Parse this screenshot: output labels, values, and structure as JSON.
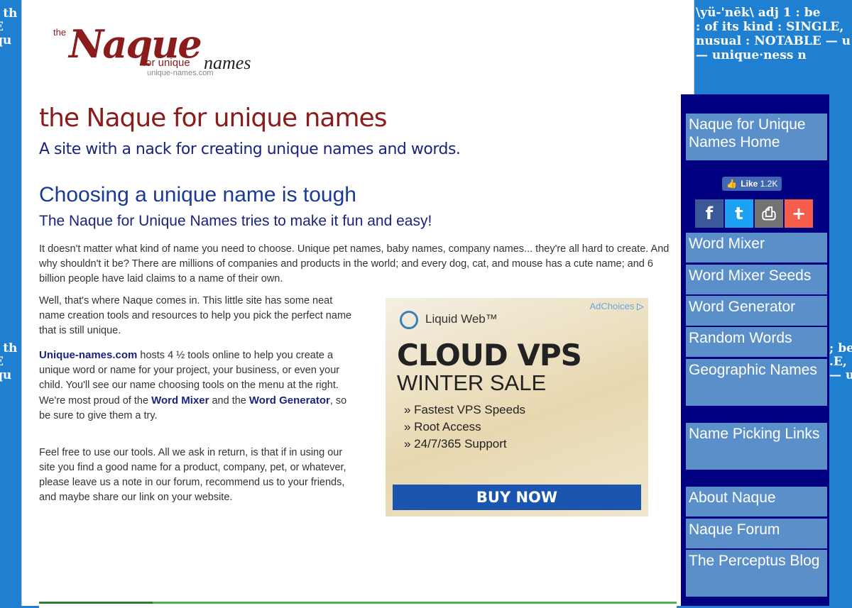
{
  "background": {
    "left_top": "; th\nE\nqu",
    "left_mid": "; th\nE\nqu",
    "right_top": "\\yü-'nēk\\ adj 1 : be\n: of its kind : SINGLE,\nnusual : NOTABLE — u\n— unique·ness n",
    "right_mid": "; be\n.E,\n— u"
  },
  "logo": {
    "the": "the",
    "naque": "Naque",
    "for_unique": "for unique",
    "names": "names",
    "url": "unique-names.com"
  },
  "header": {
    "title": "the Naque for unique names",
    "tagline": "A site with a nack for creating unique names and words."
  },
  "main": {
    "heading": "Choosing a unique name is tough",
    "subheading": "The Naque for Unique Names tries to make it fun and easy!",
    "para1": "It doesn't matter what kind of name you need to choose. Unique pet names, baby names, company names... they're all hard to create. And why shouldn't it be? There are millions of companies and products in the world; and every dog, cat, and mouse has a cute name; and 6 billion people have laid claims to a name of their own.",
    "para2": "Well, that's where Naque comes in. This little site has some neat name creation tools and resources to help you pick the perfect name that is still unique.",
    "para3_link": "Unique-names.com",
    "para3_a": " hosts 4 ½ tools online to help you create a unique word or name for your project, your business, or even your child. You'll see our name choosing tools on the menu at the right. We're most proud of the ",
    "para3_link2": "Word Mixer",
    "para3_b": " and the ",
    "para3_link3": "Word Generator",
    "para3_c": ", so be sure to give them a try.",
    "para4": "Feel free to use our tools. All we ask in return, is that if in using our site you find a good name for a product, company, pet, or whatever, please leave us a note in our forum, recommend us to your friends, and maybe share our link on your website."
  },
  "ad": {
    "choices": "AdChoices",
    "brand": "Liquid Web™",
    "headline": "CLOUD VPS",
    "subhead": "WINTER SALE",
    "bullets": [
      "» Fastest VPS Speeds",
      "» Root Access",
      "» 24/7/365 Support"
    ],
    "cta": "BUY NOW"
  },
  "sidebar": {
    "home": "Naque for Unique Names Home",
    "like_label": "Like",
    "like_count": "1.2K",
    "share": {
      "facebook": "f",
      "twitter": "t",
      "print": "⎙",
      "plus": "+"
    },
    "items": [
      "Word Mixer",
      "Word Mixer Seeds",
      "Word Generator",
      "Random Words",
      "Geographic Names"
    ],
    "links": "Name Picking Links",
    "bottom": [
      "About Naque",
      "Naque Forum",
      "The Perceptus Blog"
    ]
  },
  "colors": {
    "background": "#1f7fd1",
    "brand_red": "#8b1c1c",
    "navy": "#000080",
    "nav_item": "#5b8fc9",
    "facebook": "#3b5998",
    "twitter": "#1da1f2",
    "print": "#737373",
    "plus": "#f65d4a"
  }
}
